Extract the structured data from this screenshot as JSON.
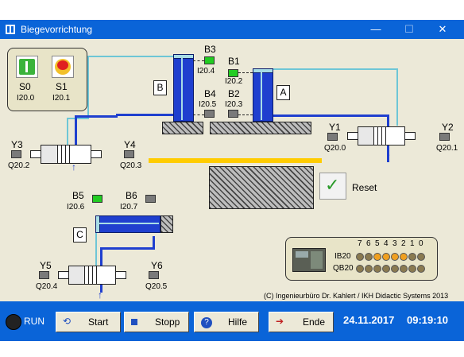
{
  "window": {
    "title": "Biegevorrichtung",
    "minimize": "—",
    "maximize": "☐",
    "close": "✕"
  },
  "panel_s": {
    "s0": {
      "label": "S0",
      "addr": "I20.0"
    },
    "s1": {
      "label": "S1",
      "addr": "I20.1"
    }
  },
  "sensors": {
    "b1": {
      "label": "B1",
      "addr": "I20.2"
    },
    "b2": {
      "label": "B2",
      "addr": "I20.3"
    },
    "b3": {
      "label": "B3",
      "addr": "I20.4"
    },
    "b4": {
      "label": "B4",
      "addr": "I20.5"
    },
    "b5": {
      "label": "B5",
      "addr": "I20.6"
    },
    "b6": {
      "label": "B6",
      "addr": "I20.7"
    }
  },
  "valves": {
    "y1": {
      "label": "Y1",
      "addr": "Q20.0"
    },
    "y2": {
      "label": "Y2",
      "addr": "Q20.1"
    },
    "y3": {
      "label": "Y3",
      "addr": "Q20.2"
    },
    "y4": {
      "label": "Y4",
      "addr": "Q20.3"
    },
    "y5": {
      "label": "Y5",
      "addr": "Q20.4"
    },
    "y6": {
      "label": "Y6",
      "addr": "Q20.5"
    }
  },
  "cylinders": {
    "a": "A",
    "b": "B",
    "c": "C"
  },
  "reset_label": "Reset",
  "io": {
    "bits": [
      "7",
      "6",
      "5",
      "4",
      "3",
      "2",
      "1",
      "0"
    ],
    "ib_label": "IB20",
    "qb_label": "QB20",
    "ib_active": [
      false,
      false,
      true,
      true,
      true,
      true,
      false,
      false
    ],
    "qb_active": [
      false,
      false,
      false,
      false,
      false,
      false,
      false,
      false
    ]
  },
  "copyright": "(C) Ingenieurbüro Dr. Kahlert / IKH Didactic Systems 2013",
  "bottom": {
    "run_label": "RUN",
    "start": "Start",
    "stopp": "Stopp",
    "hilfe": "Hilfe",
    "ende": "Ende",
    "date": "24.11.2017",
    "time": "09:19:10"
  },
  "colors": {
    "title_bar": "#0a64d8",
    "client": "#ece9d8",
    "cylinder": "#1f3fcf",
    "sensor_on": "#22cc22",
    "bar": "#ffcc00"
  }
}
